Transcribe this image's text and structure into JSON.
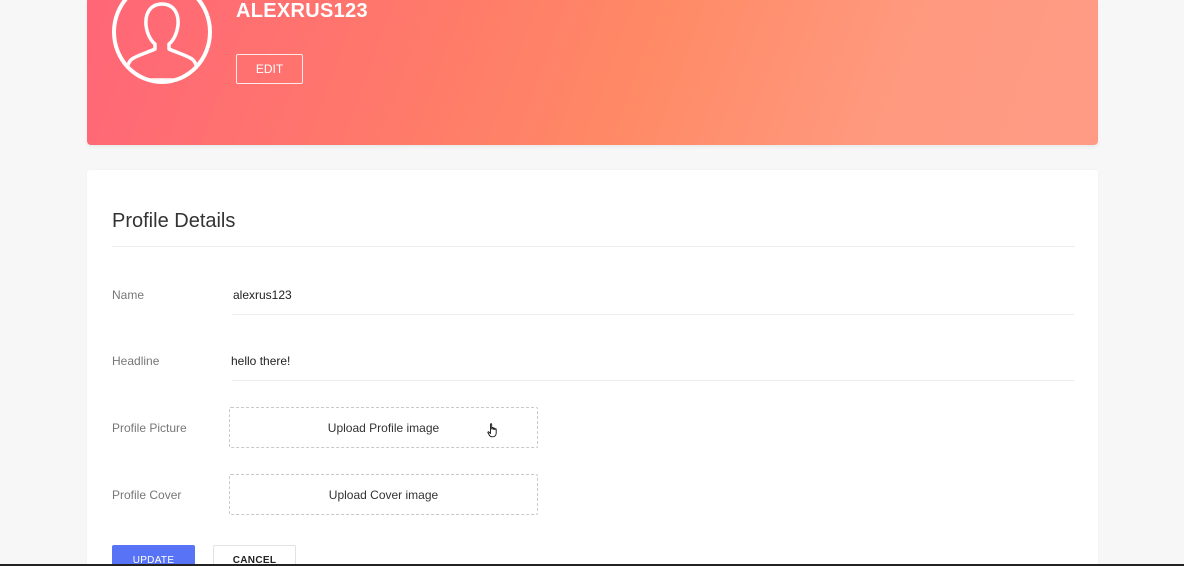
{
  "header": {
    "username": "ALEXRUS123",
    "edit_label": "EDIT",
    "gradient_start": "#ff6677",
    "gradient_end": "#ff9b85"
  },
  "profile": {
    "title": "Profile Details",
    "fields": {
      "name_label": "Name",
      "name_value": "alexrus123",
      "headline_label": "Headline",
      "headline_value": "hello there!",
      "picture_label": "Profile Picture",
      "picture_upload": "Upload Profile image",
      "cover_label": "Profile Cover",
      "cover_upload": "Upload Cover image"
    },
    "actions": {
      "update_label": "UPDATE",
      "cancel_label": "CANCEL",
      "accent": "#5873f5"
    }
  },
  "icons": {
    "avatar": "user-silhouette-icon",
    "cursor": "hand-pointer-icon"
  }
}
